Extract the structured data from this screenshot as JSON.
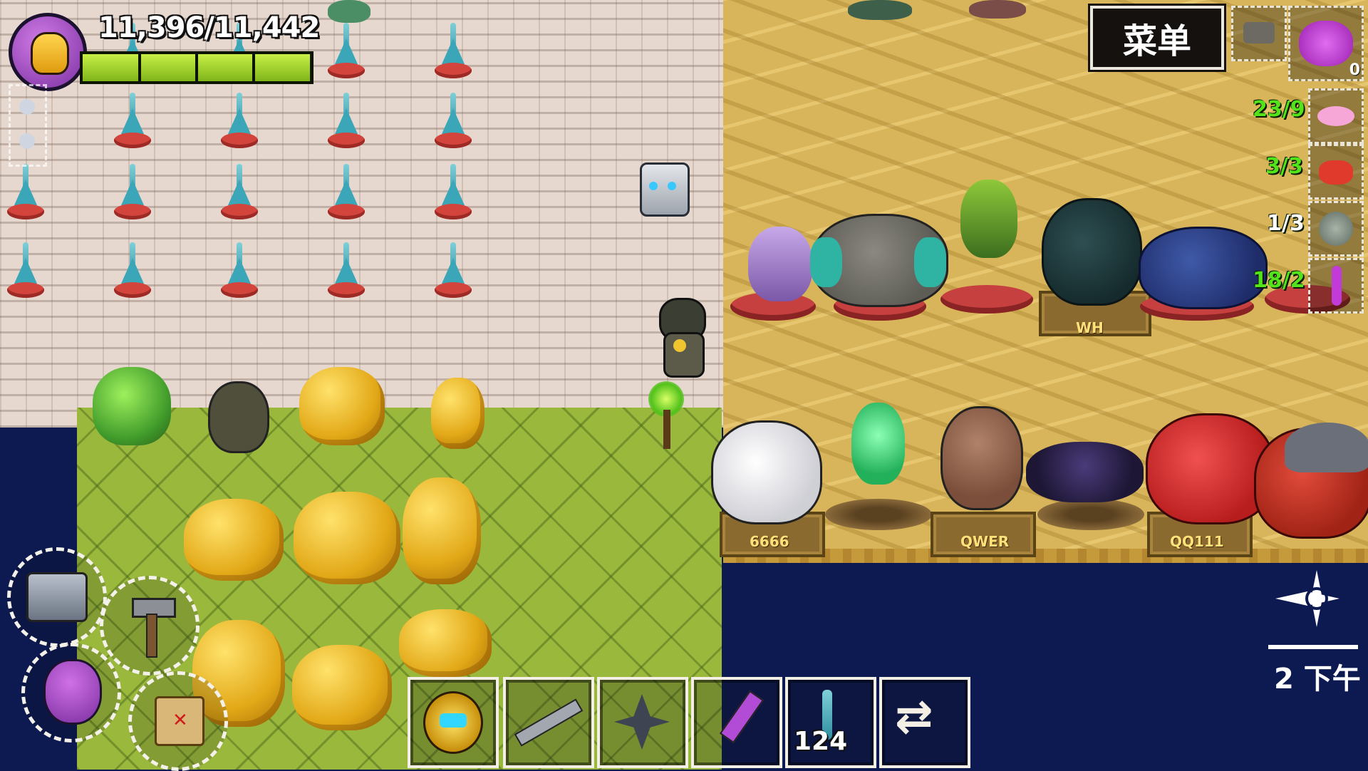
{
  "hud": {
    "health_text": "11,396/11,442",
    "health_fraction": 0.996,
    "menu_label": "菜单",
    "top_right_slot_count": "0",
    "portrait_icon": "purple-hero-portrait-icon"
  },
  "quotas": [
    {
      "text": "23/9",
      "icon": "pink-bean-icon"
    },
    {
      "text": "3/3",
      "icon": "red-crystal-icon"
    },
    {
      "text": "1/3",
      "icon": "spotted-egg-icon"
    },
    {
      "text": "18/2",
      "icon": "purple-tentacle-icon"
    }
  ],
  "pens": {
    "top": [
      "WH"
    ],
    "bottom": [
      "6666",
      "QWER",
      "QQ111"
    ]
  },
  "hotbar": {
    "count_label": "124",
    "items": [
      "golden-gem-orb-icon",
      "wrench-tool-icon",
      "bird-skeleton-icon",
      "purple-torch-icon",
      "blue-spike-plant-icon",
      "swap-arrows-icon"
    ]
  },
  "tools": [
    "device-scanner-icon",
    "hammer-icon",
    "hero-portrait-icon",
    "treasure-map-icon"
  ],
  "clock": {
    "text": "2 下午"
  },
  "colors": {
    "health_green": "#9bd626",
    "quota_green": "#52e31b",
    "menu_bg": "#14110e",
    "water": "#0d1a52"
  }
}
